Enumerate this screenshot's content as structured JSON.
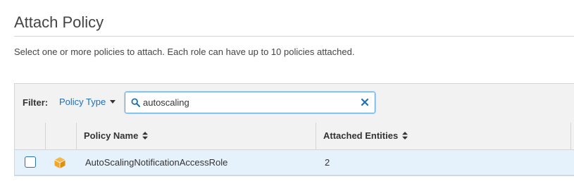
{
  "page": {
    "title": "Attach Policy",
    "description": "Select one or more policies to attach. Each role can have up to 10 policies attached."
  },
  "filter": {
    "label": "Filter:",
    "dropdown_label": "Policy Type",
    "search_value": "autoscaling",
    "search_icon": "search-icon",
    "clear_icon": "close-icon"
  },
  "table": {
    "columns": [
      "",
      "",
      "Policy Name",
      "Attached Entities"
    ],
    "rows": [
      {
        "selected": false,
        "icon": "cube-icon",
        "policy_name": "AutoScalingNotificationAccessRole",
        "attached_entities": "2"
      }
    ]
  },
  "colors": {
    "accent": "#1f6fb5",
    "row_highlight": "#e5f1fb",
    "policy_icon": "#f5a623"
  }
}
